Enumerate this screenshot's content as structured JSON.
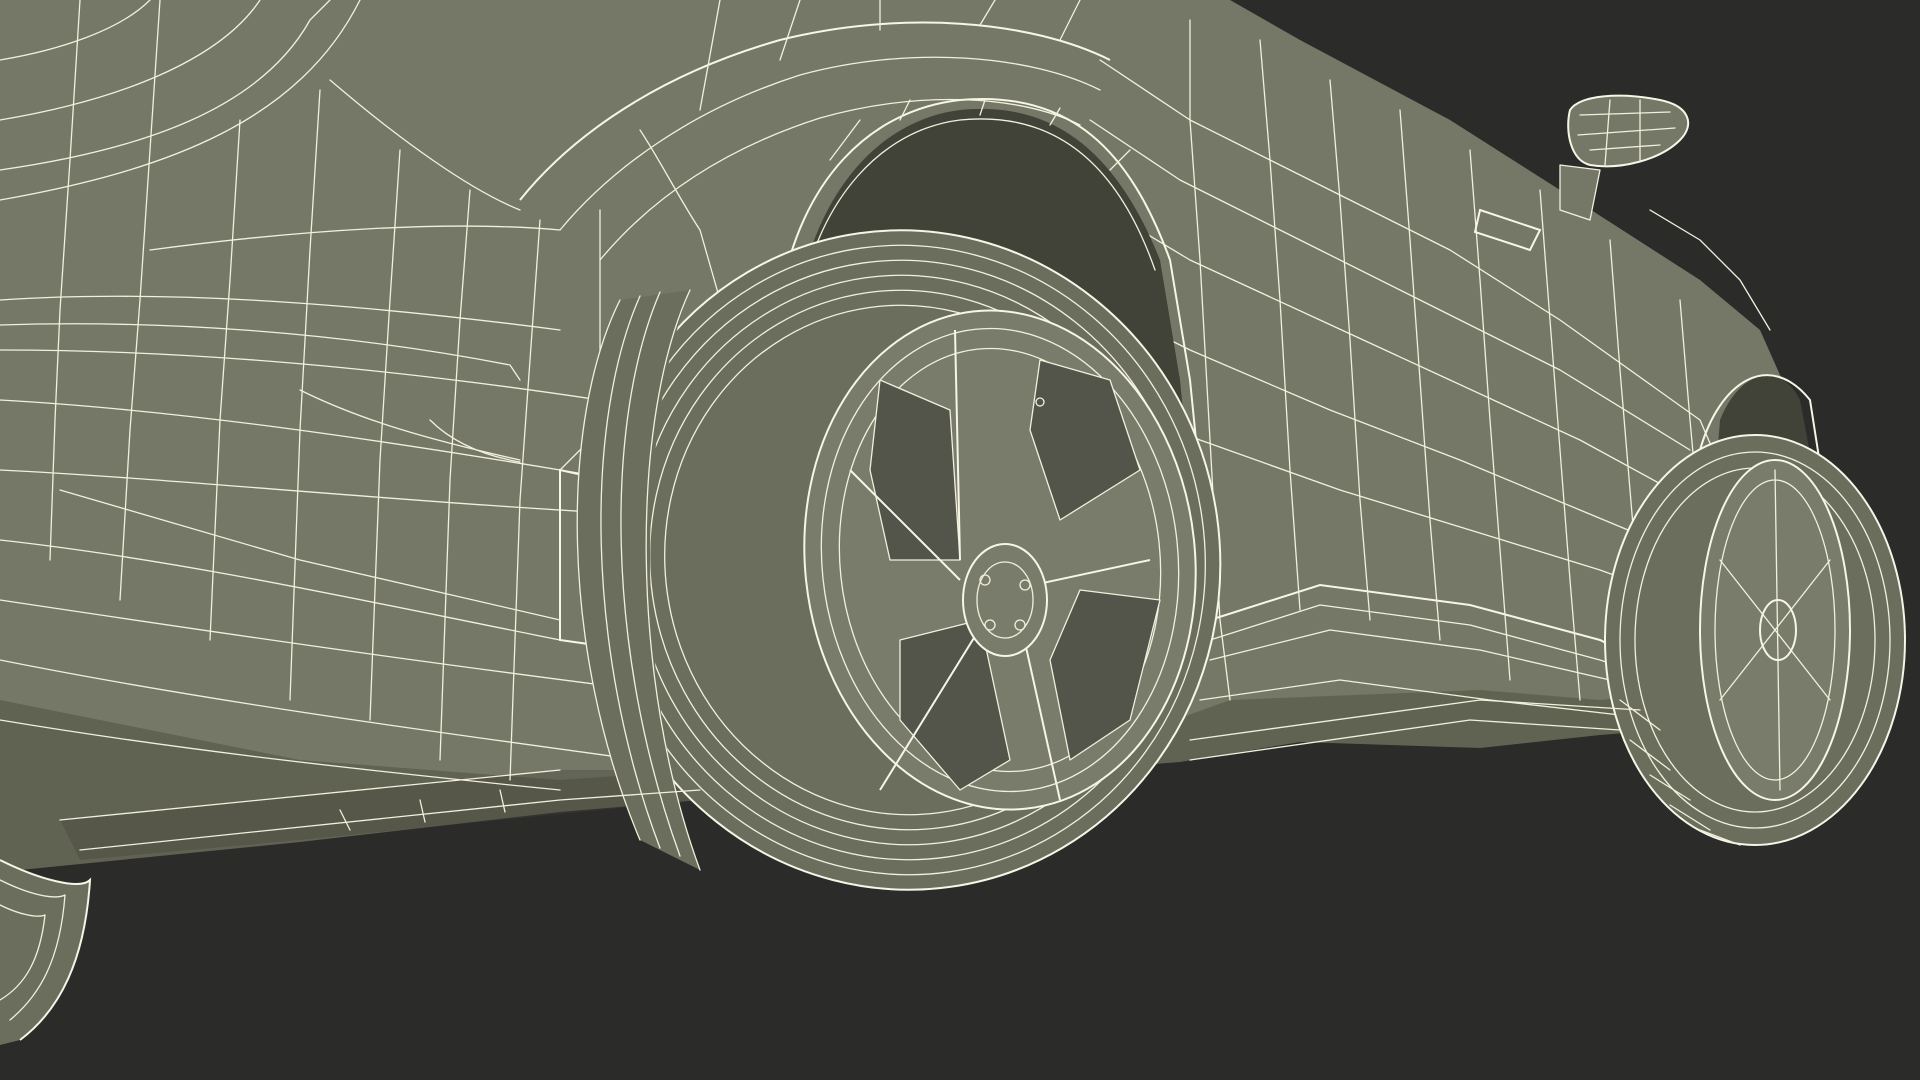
{
  "scene": {
    "subject": "wireframe-car-rear-three-quarter",
    "colors": {
      "background": "#2b2b2a",
      "body": "#767867",
      "body_shadow": "#616352",
      "wheel_arch": "#424338",
      "wire": "#f1f0dc"
    }
  }
}
